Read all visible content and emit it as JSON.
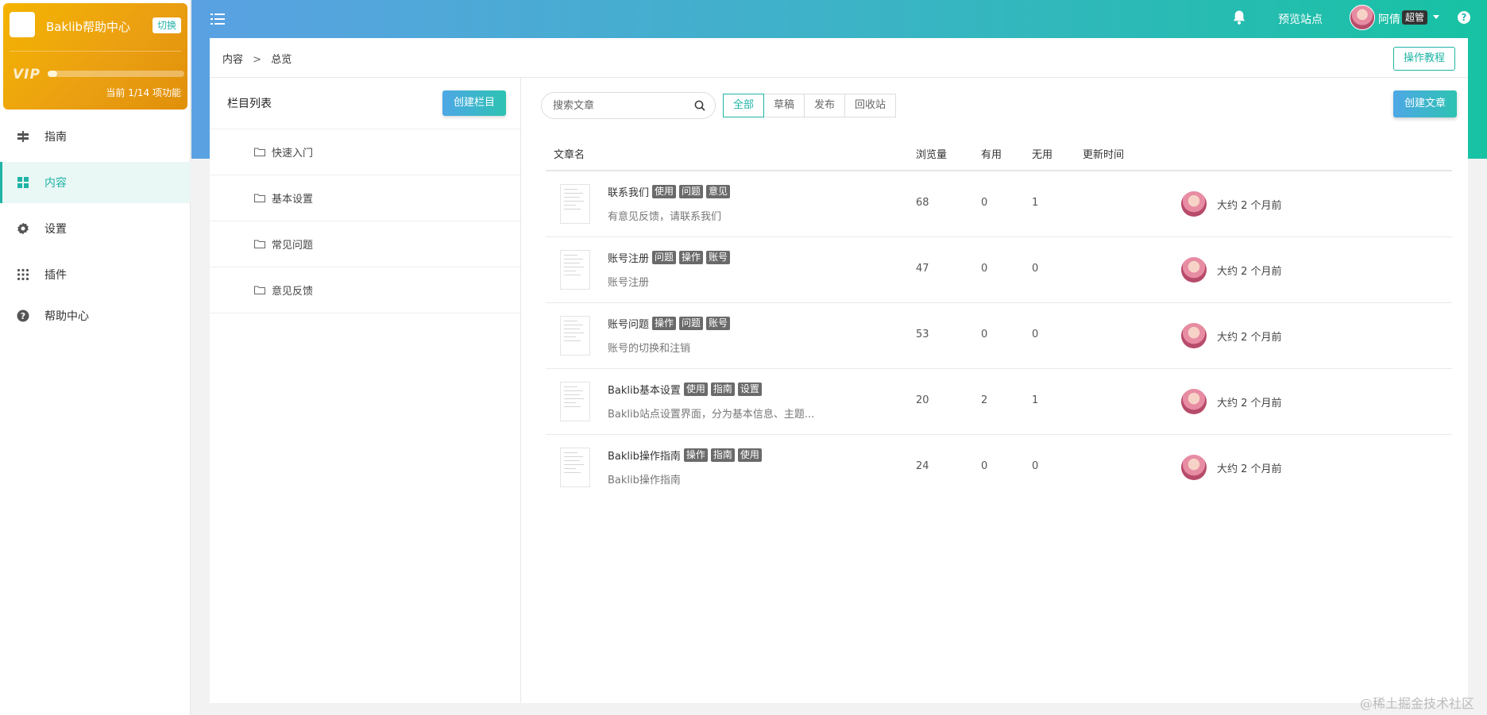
{
  "brand": {
    "name": "Baklib帮助中心",
    "switch_label": "切换",
    "vip_label": "VIP",
    "vip_progress": 0.07,
    "vip_status": "当前 1/14 项功能"
  },
  "nav": {
    "items": [
      {
        "label": "指南",
        "icon": "signpost-icon",
        "active": false
      },
      {
        "label": "内容",
        "icon": "grid-icon",
        "active": true
      },
      {
        "label": "设置",
        "icon": "gear-icon",
        "active": false
      },
      {
        "label": "插件",
        "icon": "dots-grid-icon",
        "active": false
      },
      {
        "label": "帮助中心",
        "icon": "question-icon",
        "active": false
      }
    ]
  },
  "header": {
    "preview_label": "预览站点",
    "user_name": "阿倩",
    "role_badge": "超管"
  },
  "breadcrumb": {
    "items": [
      "内容",
      "总览"
    ],
    "separator": ">"
  },
  "tutorial_label": "操作教程",
  "columns": {
    "title": "栏目列表",
    "create_label": "创建栏目",
    "items": [
      "快速入门",
      "基本设置",
      "常见问题",
      "意见反馈"
    ]
  },
  "articles": {
    "search_placeholder": "搜索文章",
    "filters": [
      "全部",
      "草稿",
      "发布",
      "回收站"
    ],
    "active_filter": 0,
    "create_label": "创建文章",
    "headers": {
      "name": "文章名",
      "views": "浏览量",
      "useful": "有用",
      "useless": "无用",
      "updated": "更新时间"
    },
    "rows": [
      {
        "title": "联系我们",
        "tags": [
          "使用",
          "问题",
          "意见"
        ],
        "desc": "有意见反馈，请联系我们",
        "views": "68",
        "useful": "0",
        "useless": "1",
        "updated": "大约 2 个月前"
      },
      {
        "title": "账号注册",
        "tags": [
          "问题",
          "操作",
          "账号"
        ],
        "desc": "账号注册",
        "views": "47",
        "useful": "0",
        "useless": "0",
        "updated": "大约 2 个月前"
      },
      {
        "title": "账号问题",
        "tags": [
          "操作",
          "问题",
          "账号"
        ],
        "desc": "账号的切换和注销",
        "views": "53",
        "useful": "0",
        "useless": "0",
        "updated": "大约 2 个月前"
      },
      {
        "title": "Baklib基本设置",
        "tags": [
          "使用",
          "指南",
          "设置"
        ],
        "desc": "Baklib站点设置界面，分为基本信息、主题...",
        "views": "20",
        "useful": "2",
        "useless": "1",
        "updated": "大约 2 个月前"
      },
      {
        "title": "Baklib操作指南",
        "tags": [
          "操作",
          "指南",
          "使用"
        ],
        "desc": "Baklib操作指南",
        "views": "24",
        "useful": "0",
        "useless": "0",
        "updated": "大约 2 个月前"
      }
    ]
  },
  "watermark": "@稀土掘金技术社区",
  "colors": {
    "accent": "#1fb4a5",
    "brand_gold": "#eba012",
    "header_start": "#5aa1e3",
    "header_end": "#17c2a3",
    "tag_bg": "#6a6a6a"
  }
}
